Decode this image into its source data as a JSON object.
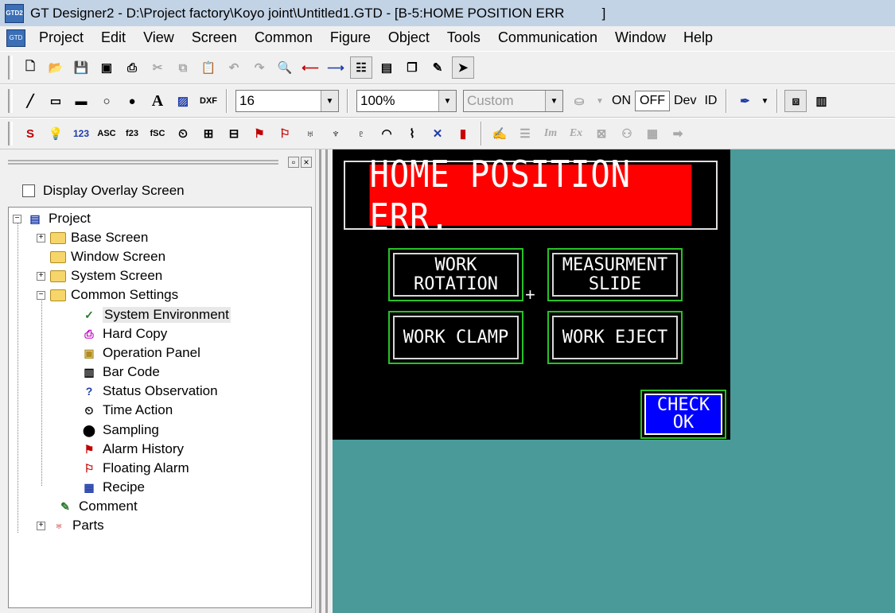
{
  "window": {
    "title": "GT Designer2 - D:\\Project factory\\Koyo joint\\Untitled1.GTD - [B-5:HOME POSITION ERR          ]",
    "app_icon": "GTD2"
  },
  "menu": [
    "Project",
    "Edit",
    "View",
    "Screen",
    "Common",
    "Figure",
    "Object",
    "Tools",
    "Communication",
    "Window",
    "Help"
  ],
  "toolbar2": {
    "font_size": "16",
    "zoom": "100%",
    "custom": "Custom",
    "on": "ON",
    "off": "OFF",
    "dev": "Dev",
    "id": "ID",
    "dxf": "DXF",
    "text_a": "A"
  },
  "toolbar3": {
    "num": "123",
    "asc": "ASC",
    "s": "S"
  },
  "left_panel": {
    "overlay_label": "Display Overlay Screen"
  },
  "tree": {
    "project": "Project",
    "base_screen": "Base Screen",
    "window_screen": "Window Screen",
    "system_screen": "System Screen",
    "common_settings": "Common Settings",
    "system_environment": "System Environment",
    "hard_copy": "Hard Copy",
    "operation_panel": "Operation Panel",
    "bar_code": "Bar Code",
    "status_observation": "Status Observation",
    "time_action": "Time Action",
    "sampling": "Sampling",
    "alarm_history": "Alarm History",
    "floating_alarm": "Floating Alarm",
    "recipe": "Recipe",
    "comment": "Comment",
    "parts": "Parts"
  },
  "screen": {
    "error_title": "HOME POSITION ERR.",
    "btn_work_rotation": "WORK\nROTATION",
    "btn_measurment_slide": "MEASURMENT\nSLIDE",
    "btn_work_clamp": "WORK CLAMP",
    "btn_work_eject": "WORK EJECT",
    "btn_check_ok": "CHECK\nOK",
    "plus": "+"
  },
  "colors": {
    "canvas_bg": "#4a9a9a",
    "error_red": "#ff0000",
    "ok_blue": "#0000ff",
    "button_border": "#27c227"
  }
}
